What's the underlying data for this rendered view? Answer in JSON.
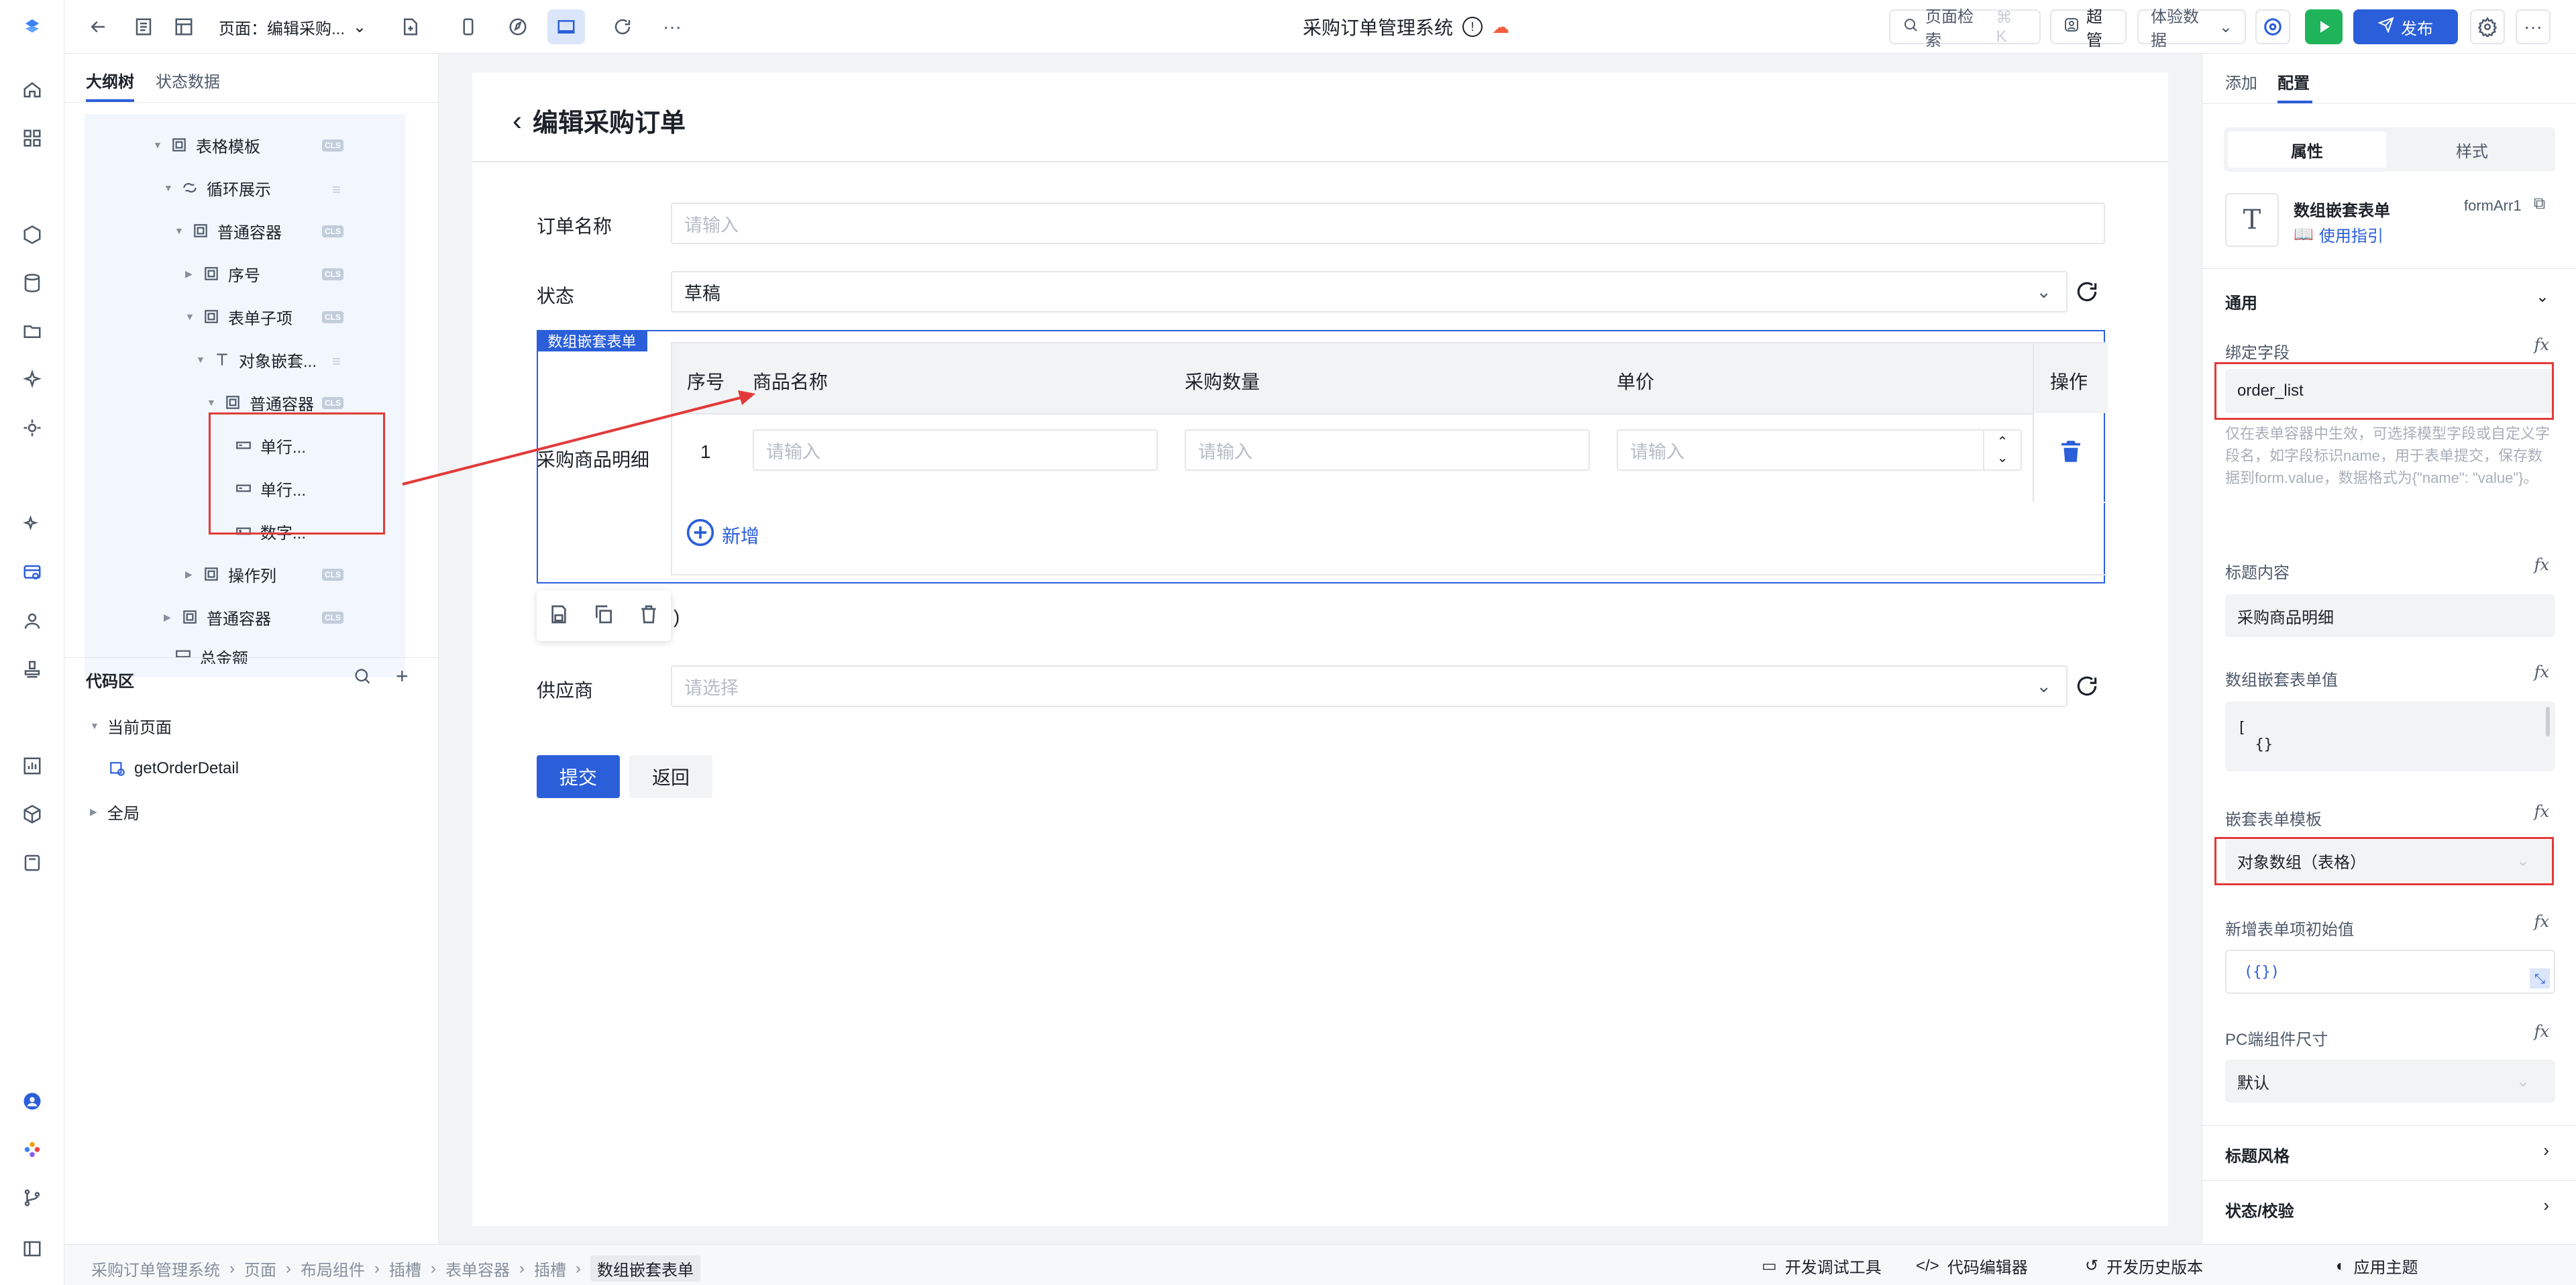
{
  "app": {
    "title": "采购订单管理系统",
    "page_selector": "页面：编辑采购...",
    "search_label": "页面检索",
    "search_shortcut": "⌘ K",
    "user": "超管",
    "experience_data": "体验数据",
    "publish": "发布"
  },
  "left": {
    "tabs": [
      "大纲树",
      "状态数据"
    ],
    "tree": [
      {
        "label": "表格模板",
        "badge": "CLS"
      },
      {
        "label": "循环展示",
        "badge": "db"
      },
      {
        "label": "普通容器",
        "badge": "CLS"
      },
      {
        "label": "序号",
        "badge": "CLS"
      },
      {
        "label": "表单子项",
        "badge": "CLS"
      },
      {
        "label": "对象嵌套...",
        "badge": "db"
      },
      {
        "label": "普通容器",
        "badge": "CLS"
      },
      {
        "label": "单行..."
      },
      {
        "label": "单行..."
      },
      {
        "label": "数字..."
      },
      {
        "label": "操作列",
        "badge": "CLS"
      },
      {
        "label": "普通容器",
        "badge": "CLS"
      },
      {
        "label": "总金额",
        "badge": "db"
      }
    ],
    "code_title": "代码区",
    "code_current_page": "当前页面",
    "code_function": "getOrderDetail",
    "code_global": "全局"
  },
  "canvas": {
    "page_title": "编辑采购订单",
    "order_name_label": "订单名称",
    "order_name_placeholder": "请输入",
    "status_label": "状态",
    "status_value": "草稿",
    "selection_tag": "数组嵌套表单",
    "items_label": "采购商品明细",
    "table_headers": [
      "序号",
      "商品名称",
      "采购数量",
      "单价",
      "操作"
    ],
    "row_index": "1",
    "cell_placeholder": "请输入",
    "add_label": "新增",
    "partial_text": ")",
    "supplier_label": "供应商",
    "supplier_placeholder": "请选择",
    "submit": "提交",
    "back": "返回"
  },
  "right": {
    "tabs": [
      "添加",
      "配置"
    ],
    "seg": [
      "属性",
      "样式"
    ],
    "component_name": "数组嵌套表单",
    "component_id": "formArr1",
    "guide": "使用指引",
    "group_general": "通用",
    "bind_field_label": "绑定字段",
    "bind_field_value": "order_list",
    "bind_field_help": "仅在表单容器中生效，可选择模型字段或自定义字段名，如字段标识name，用于表单提交，保存数据到form.value，数据格式为{\"name\": \"value\"}。",
    "title_content_label": "标题内容",
    "title_content_value": "采购商品明细",
    "array_value_label": "数组嵌套表单值",
    "array_value_line1": "[",
    "array_value_line2": "  {}",
    "template_label": "嵌套表单模板",
    "template_value": "对象数组（表格）",
    "initial_label": "新增表单项初始值",
    "initial_value": "({})",
    "size_label": "PC端组件尺寸",
    "size_value": "默认",
    "group_title_style": "标题风格",
    "group_validate": "状态/校验",
    "fx": "fx"
  },
  "bottom": {
    "breadcrumb": [
      "采购订单管理系统",
      "页面",
      "布局组件",
      "插槽",
      "表单容器",
      "插槽",
      "数组嵌套表单"
    ],
    "debug": "开发调试工具",
    "code_editor": "代码编辑器",
    "history": "开发历史版本",
    "theme": "应用主题"
  },
  "colors": {
    "primary": "#2b5fd9",
    "annot_red": "#e23a3a",
    "green": "#1fb45a"
  }
}
